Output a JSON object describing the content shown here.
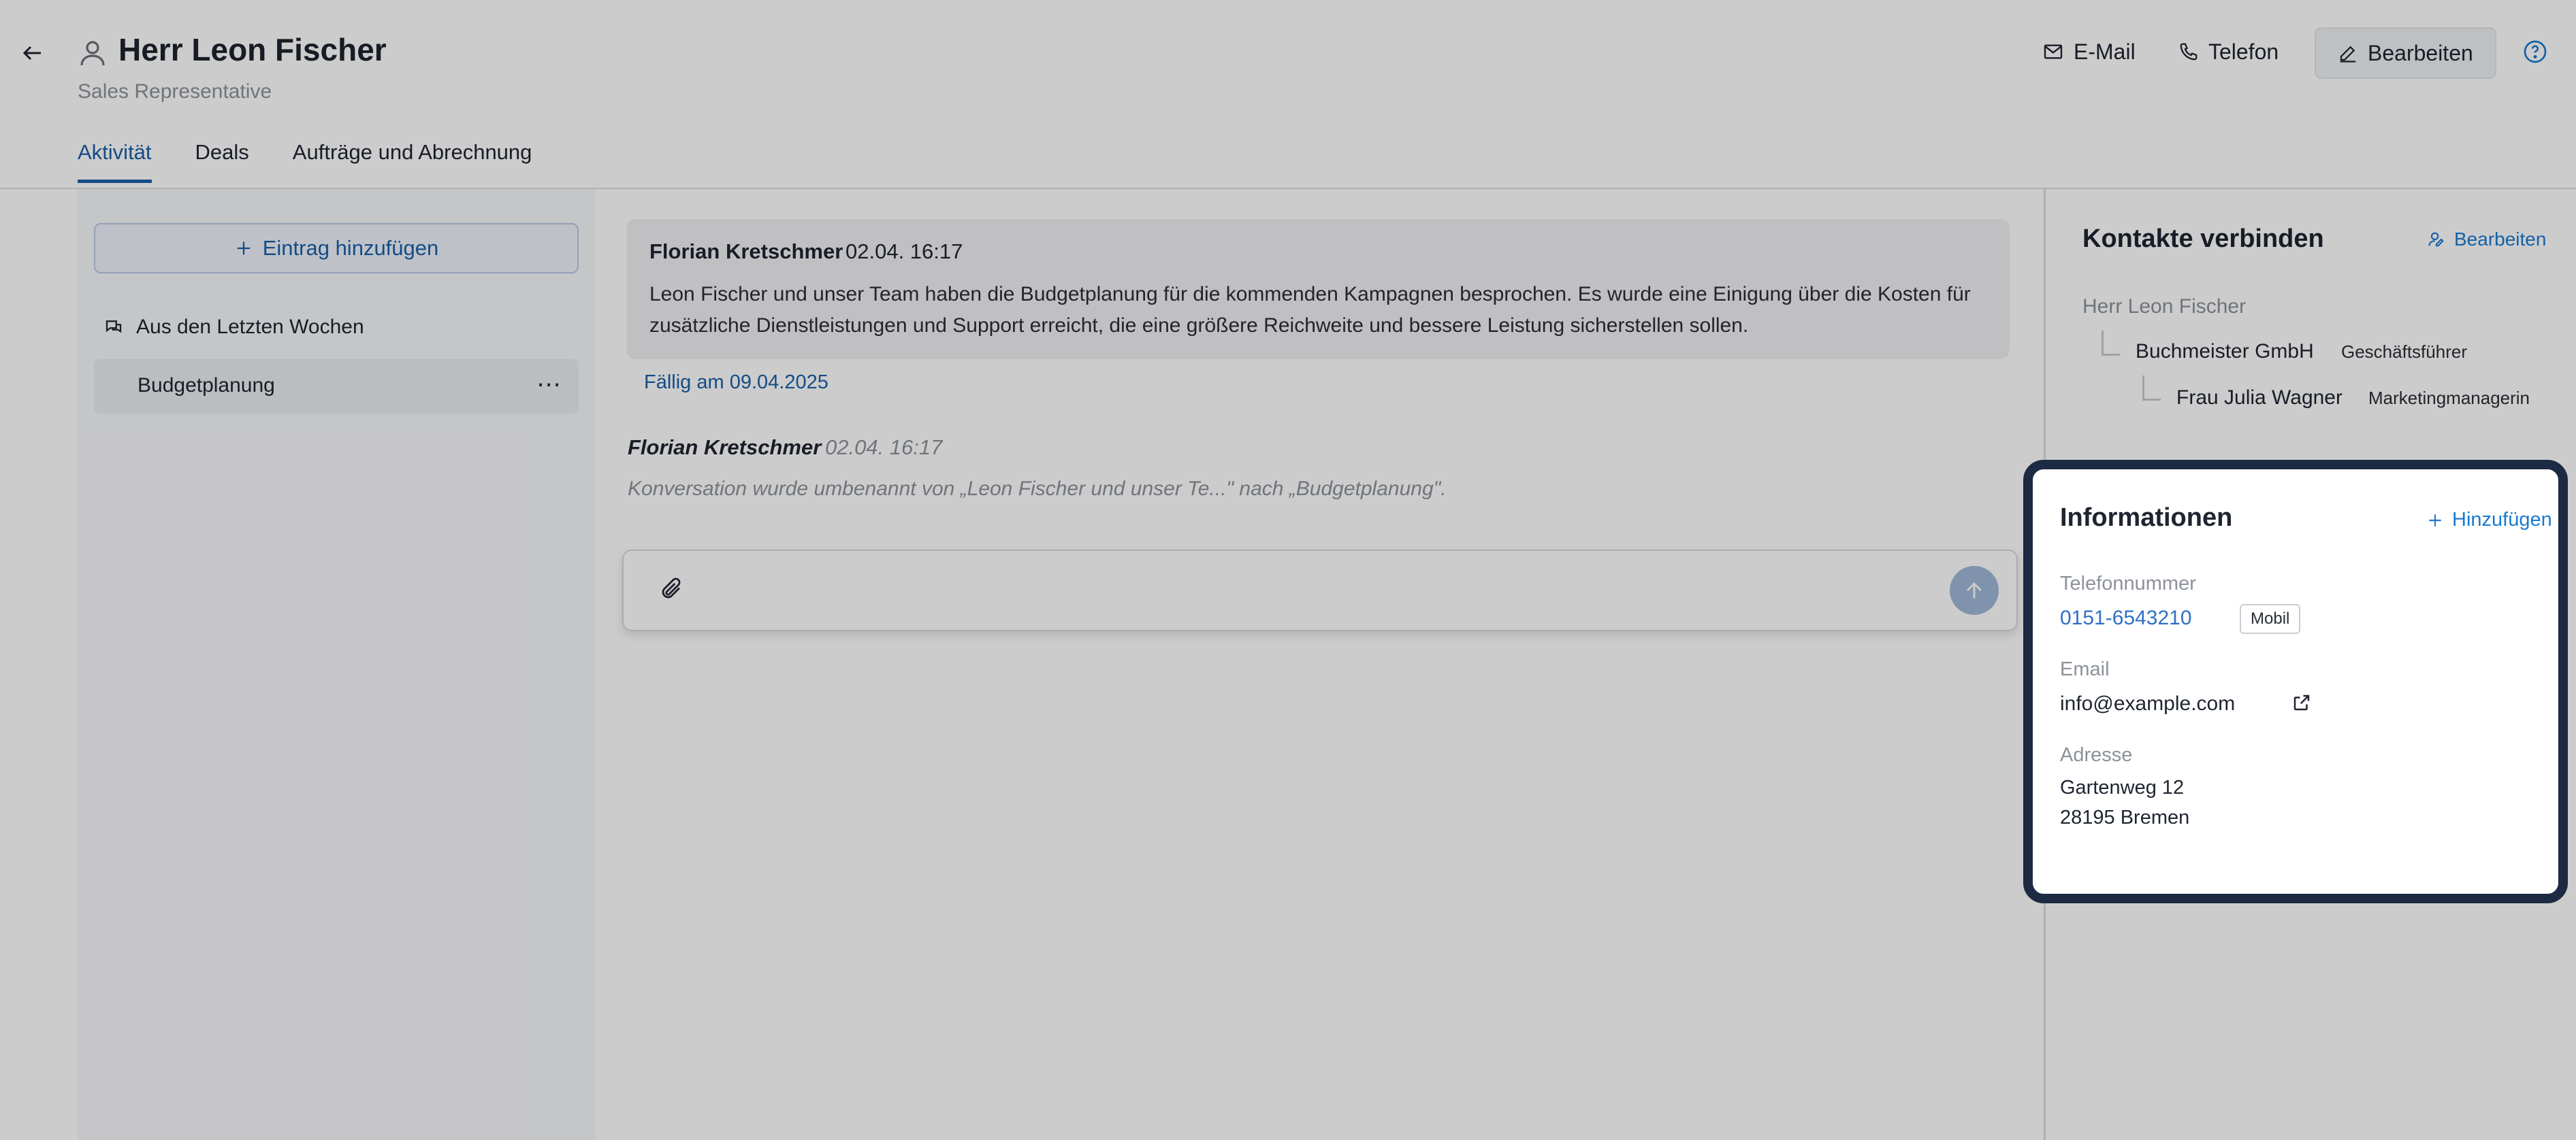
{
  "header": {
    "title": "Herr Leon Fischer",
    "subtitle": "Sales Representative",
    "buttons": {
      "email": "E-Mail",
      "phone": "Telefon",
      "edit": "Bearbeiten"
    }
  },
  "tabs": [
    {
      "label": "Aktivität",
      "active": true
    },
    {
      "label": "Deals",
      "active": false
    },
    {
      "label": "Aufträge und Abrechnung",
      "active": false
    }
  ],
  "left": {
    "add_entry": "Eintrag hinzufügen",
    "group_label": "Aus den Letzten Wochen",
    "conversation": "Budgetplanung",
    "more": "⋯"
  },
  "feed": {
    "message": {
      "author": "Florian Kretschmer",
      "time": "02.04. 16:17",
      "body": "Leon Fischer und unser Team haben die Budgetplanung für die kommenden Kampagnen besprochen. Es wurde eine Einigung über die Kosten für zusätzliche Dienstleistungen und Support erreicht, die eine größere Reichweite und bessere Leistung sicherstellen sollen."
    },
    "due": "Fällig am 09.04.2025",
    "log": {
      "author": "Florian Kretschmer",
      "time": "02.04. 16:17",
      "text": "Konversation wurde umbenannt von „Leon Fischer und unser Te...\" nach „Budgetplanung\"."
    }
  },
  "contacts": {
    "title": "Kontakte verbinden",
    "edit": "Bearbeiten",
    "root": "Herr Leon Fischer",
    "company": "Buchmeister GmbH",
    "company_role": "Geschäftsführer",
    "person": "Frau Julia Wagner",
    "person_role": "Marketingmanagerin"
  },
  "info": {
    "title": "Informationen",
    "add": "Hinzufügen",
    "phone_label": "Telefonnummer",
    "phone": "0151-6543210",
    "phone_type": "Mobil",
    "email_label": "Email",
    "email": "info@example.com",
    "address_label": "Adresse",
    "street": "Gartenweg 12",
    "city": "28195 Bremen"
  },
  "colors": {
    "accent": "#1a5fa8",
    "link": "#1a7ad0",
    "highlight_border": "#1c2a44"
  }
}
